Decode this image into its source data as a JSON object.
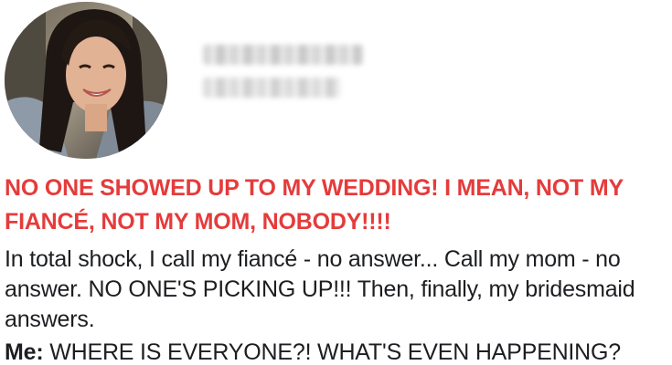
{
  "post": {
    "headline": "NO ONE SHOWED UP TO MY WEDDING! I MEAN, NOT MY FIANCÉ, NOT MY MOM, NOBODY!!!!",
    "body": "In total shock, I call my fiancé - no answer... Call my mom - no answer. NO ONE'S PICKING UP!!! Then, finally, my bridesmaid answers.",
    "dialogue": {
      "speaker": "Me:",
      "text": "WHERE IS EVERYONE?! WHAT'S EVEN HAPPENING?"
    }
  },
  "author": {
    "avatar_icon": "profile-photo",
    "name_blurred": true
  },
  "colors": {
    "headline": "#e53b3b",
    "body": "#1c1e21",
    "background": "#ffffff"
  }
}
